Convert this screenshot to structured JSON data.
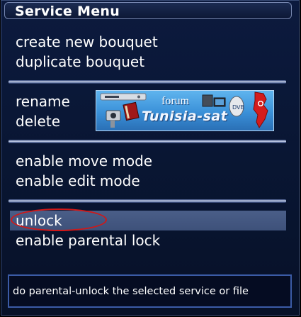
{
  "window": {
    "title": "Service Menu"
  },
  "menu": {
    "group1": [
      "create new bouquet",
      "duplicate bouquet"
    ],
    "group2": [
      "rename",
      "delete"
    ],
    "group3": [
      "enable move mode",
      "enable edit mode"
    ],
    "group4": [
      "unlock",
      "enable parental lock"
    ],
    "selected": "unlock"
  },
  "banner": {
    "line1": "forum",
    "line2": "Tunisia-sat",
    "badge": "DVB"
  },
  "status": {
    "text": "do parental-unlock the selected service or file"
  },
  "colors": {
    "background": "#091633",
    "selection": "#44577f",
    "highlight_oval": "#d01818",
    "separator": "#c8d2ea",
    "status_border": "#3b5ba6",
    "text": "#ffffff"
  },
  "icons": [
    "satellite-receiver-icon",
    "camera-icon",
    "book-icon",
    "pc-icon",
    "satellite-dish-icon",
    "tunisia-map-icon"
  ]
}
